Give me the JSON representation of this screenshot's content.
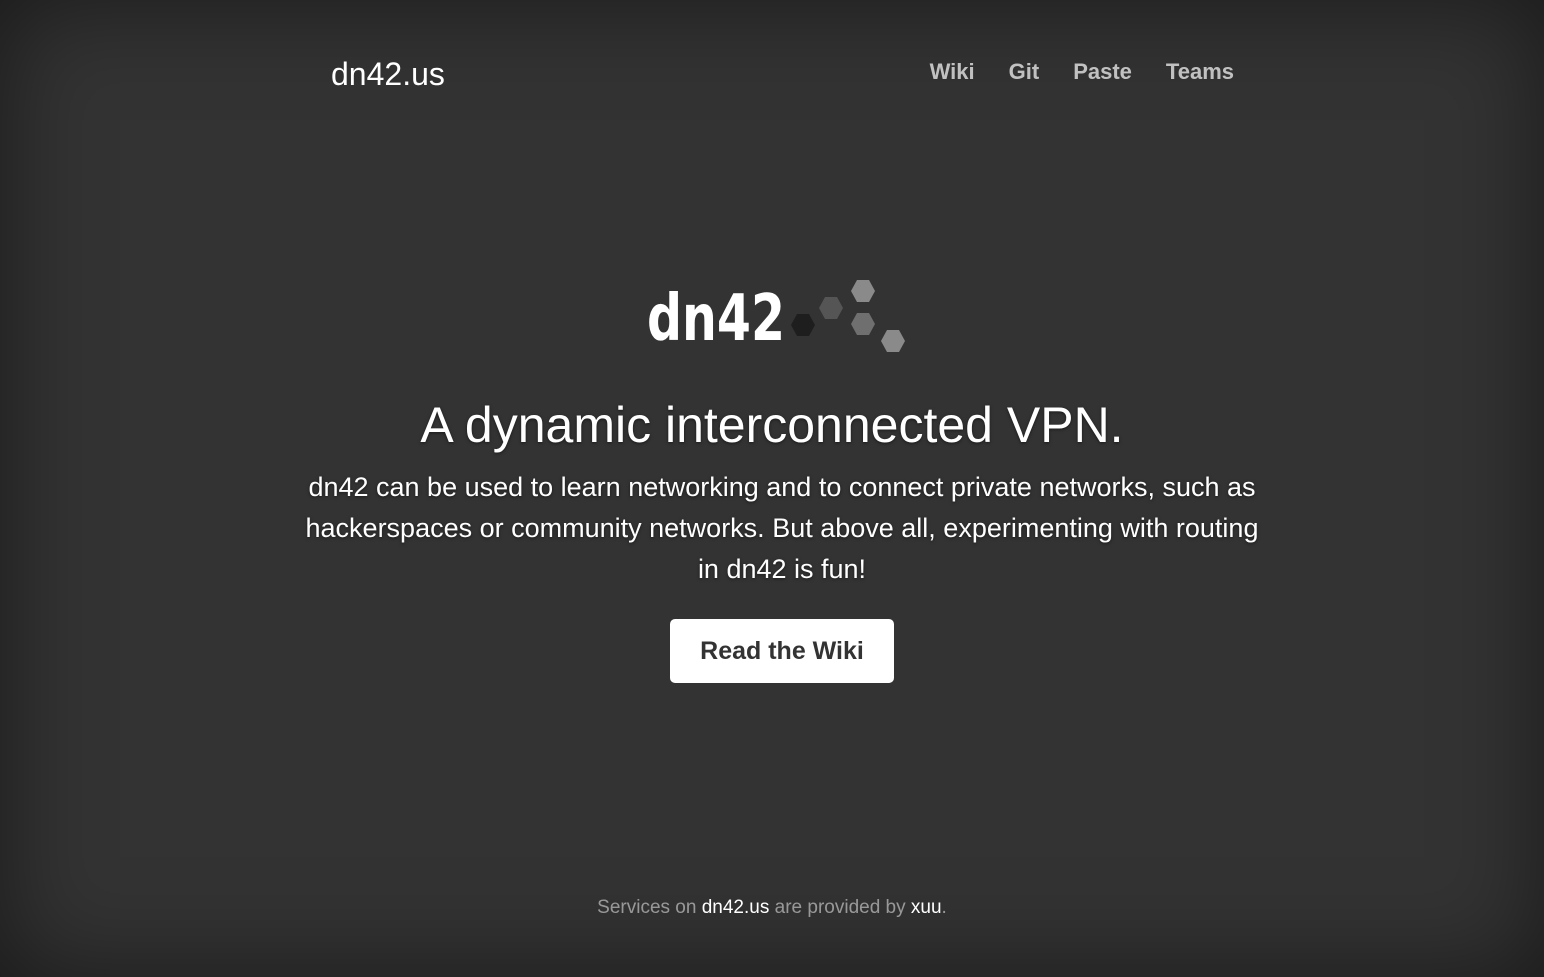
{
  "header": {
    "brand": "dn42.us",
    "nav": [
      {
        "label": "Wiki"
      },
      {
        "label": "Git"
      },
      {
        "label": "Paste"
      },
      {
        "label": "Teams"
      }
    ]
  },
  "hero": {
    "logo_text": "dn42",
    "title": "A dynamic interconnected VPN.",
    "lead": "dn42 can be used to learn networking and to connect private networks, such as hackerspaces or community networks. But above all, experimenting with routing in dn42 is fun!",
    "button_label": "Read the Wiki"
  },
  "footer": {
    "prefix": "Services on",
    "site_link": "dn42.us",
    "middle": "are provided by",
    "provider_link": "xuu",
    "suffix": "."
  },
  "colors": {
    "background": "#333333",
    "text": "#ffffff",
    "button_bg": "#ffffff",
    "button_text": "#333333"
  }
}
